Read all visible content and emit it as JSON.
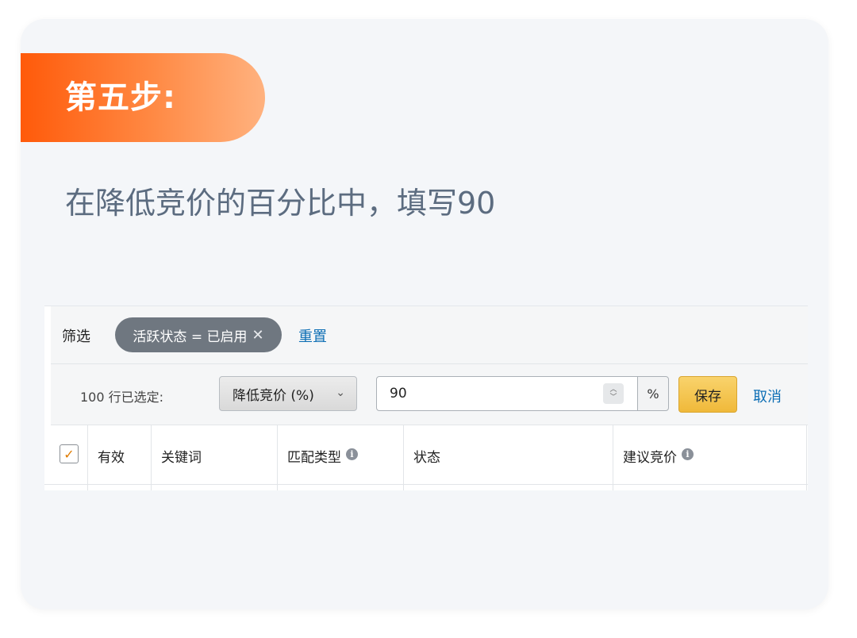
{
  "step": {
    "label": "第五步:"
  },
  "instruction": "在降低竞价的百分比中，填写90",
  "filter_bar": {
    "label": "筛选",
    "chip_text": "活跃状态 = 已启用",
    "chip_close_icon": "close-icon",
    "reset_label": "重置"
  },
  "action_bar": {
    "selected_count": "100 行已选定:",
    "dropdown_value": "降低竞价 (%)",
    "bid_input_value": "90",
    "unit": "%",
    "save_label": "保存",
    "cancel_label": "取消"
  },
  "table": {
    "columns": [
      "有效",
      "关键词",
      "匹配类型",
      "状态",
      "建议竞价"
    ],
    "header_checkbox_checked": true
  },
  "colors": {
    "badge_start": "#ff5a0a",
    "badge_end": "#ffb27f",
    "link": "#0e6fb5",
    "save_button": "#f0b93a"
  }
}
